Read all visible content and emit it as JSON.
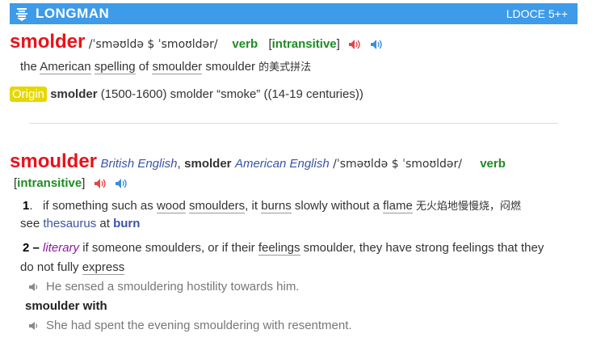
{
  "banner": {
    "brand": "LONGMAN",
    "edition": "LDOCE 5++"
  },
  "entry1": {
    "headword": "smolder",
    "pron": "/ˈsməʊldə $ ˈsmoʊldər/",
    "pos": "verb",
    "gram_open": "[",
    "gram": "intransitive",
    "gram_close": "]",
    "gloss_prefix": "the ",
    "gloss_american": "American",
    "gloss_space1": " ",
    "gloss_spelling": "spelling",
    "gloss_of": " of ",
    "gloss_smoulder": "smoulder",
    "gloss_cn_word": " smoulder",
    "gloss_cn": " 的美式拼法",
    "origin_label": "Origin",
    "origin_word": "smolder",
    "origin_text": " (1500-1600) smolder “smoke” ((14-19 centuries))"
  },
  "entry2": {
    "headword": "smoulder",
    "british": "British English",
    "comma": ",",
    "smolder": "smolder",
    "american": "American English",
    "pron": "/ˈsməʊldə $ ˈsmoʊldər/",
    "pos": "verb",
    "gram_open": "[",
    "gram": "intransitive",
    "gram_close": "]",
    "sense1": {
      "num": "1",
      "dot": ".",
      "t1": "if something such as ",
      "wood": "wood",
      "t2": " ",
      "smoulders": "smoulders",
      "t3": ", it ",
      "burns": "burns",
      "t4": " slowly without a ",
      "flame": "flame",
      "cn": " 无火焰地慢慢烧，闷燃",
      "see": "see ",
      "thesaurus": "thesaurus",
      "at": " at ",
      "burn": "burn"
    },
    "sense2": {
      "num": "2",
      "dash": "–",
      "literary": "literary",
      "t1": " if someone smoulders, or if their ",
      "feelings": "feelings",
      "t2": " smoulder, they have strong feelings that they",
      "t3": "do not fully ",
      "express": "express",
      "example": "He sensed a smouldering hostility towards him.",
      "phrase": "smoulder with",
      "phrase_example": "She had spent the evening smouldering with resentment."
    }
  },
  "colors": {
    "banner": "#3d9be9",
    "headword": "#e8131b",
    "grammar": "#1f8b24",
    "link": "#3a54a5",
    "origin": "#e6d700",
    "literary": "#8a1b9c"
  },
  "icons": [
    "longman-logo-icon",
    "speaker-red-icon",
    "speaker-blue-icon",
    "speaker-grey-icon"
  ]
}
